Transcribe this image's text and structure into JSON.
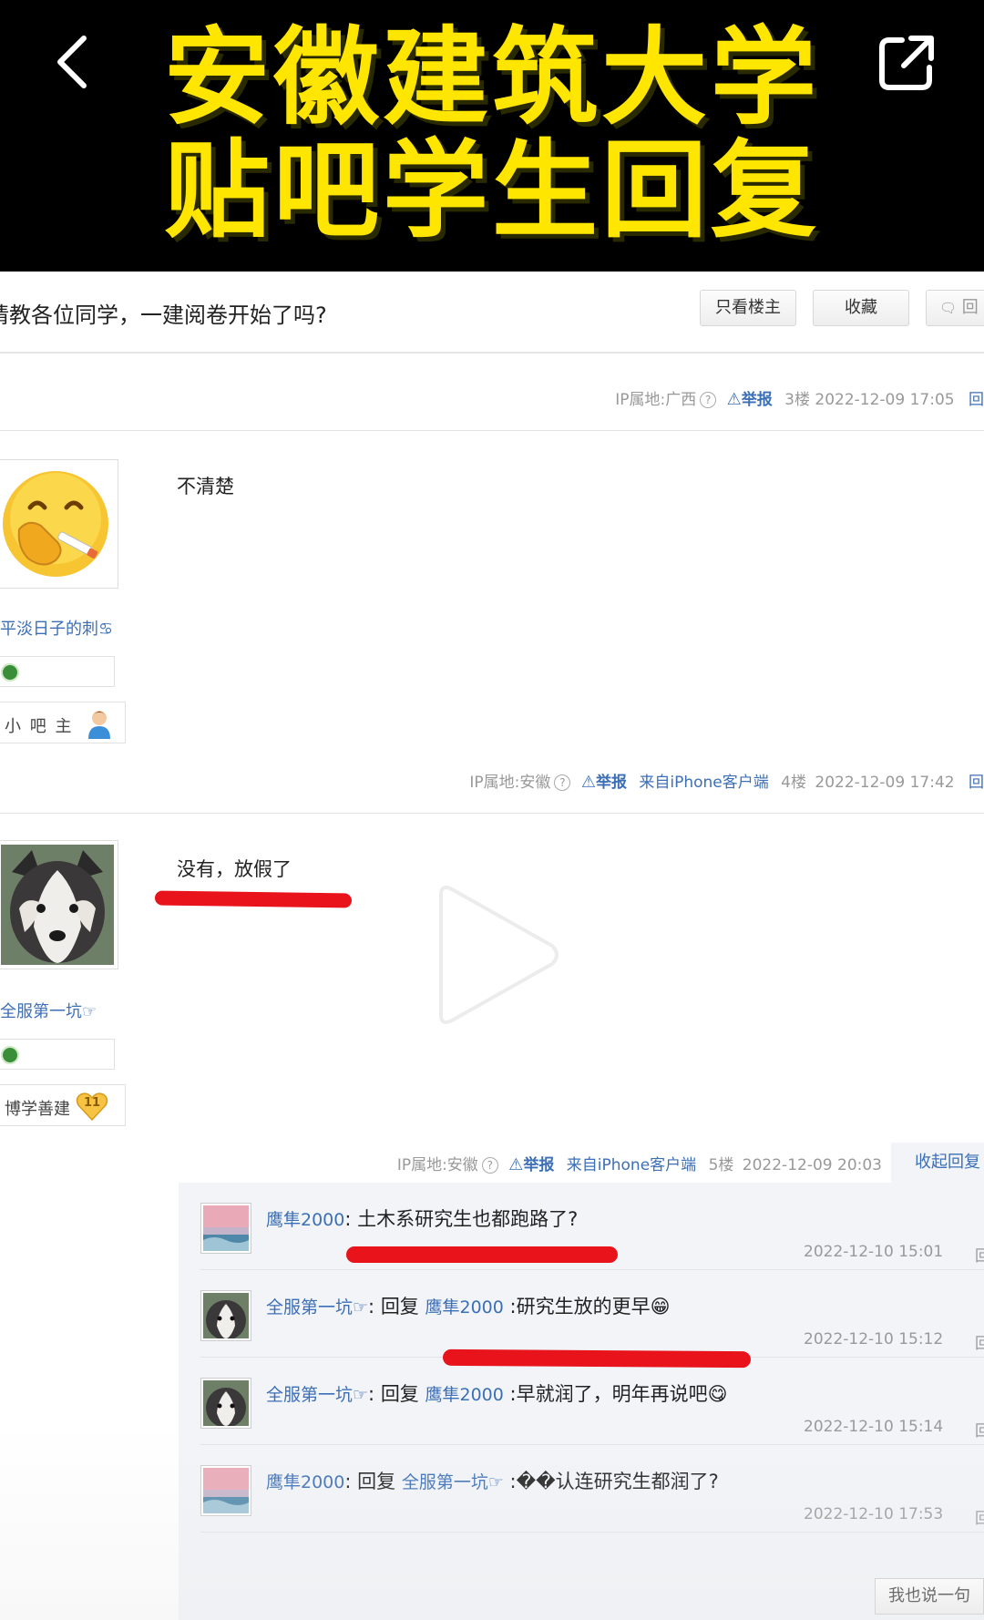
{
  "banner": {
    "line1": "安徽建筑大学",
    "line2": "贴吧学生回复",
    "accent": "#ffe600"
  },
  "thread": {
    "title": "请教各位同学，一建阅卷开始了吗?",
    "buttons": [
      "只看楼主",
      "收藏",
      "回"
    ]
  },
  "floor3_meta": {
    "ip": "IP属地:广西",
    "report": "举报",
    "floor": "3楼",
    "time": "2022-12-09 17:05",
    "cut": "回"
  },
  "post4": {
    "username": "平淡日子的刺♋",
    "role": "小 吧 主",
    "text": "不清楚",
    "meta": {
      "ip": "IP属地:安徽",
      "report": "举报",
      "source": "来自iPhone客户端",
      "floor": "4楼",
      "time": "2022-12-09 17:42",
      "cut": "回"
    }
  },
  "post5": {
    "username": "全服第一坑☞",
    "role": "博学善建",
    "level": "11",
    "text": "没有，放假了",
    "meta": {
      "ip": "IP属地:安徽",
      "report": "举报",
      "source": "来自iPhone客户端",
      "floor": "5楼",
      "time": "2022-12-09 20:03"
    },
    "collapse": "收起回复"
  },
  "comments": [
    {
      "user": "鹰隼2000",
      "sep": ": ",
      "prefix": "",
      "target": "",
      "text": "土木系研究生也都跑路了?",
      "time": "2022-12-10 15:01",
      "reply": "回复",
      "avatar": "sunset"
    },
    {
      "user": "全服第一坑☞",
      "sep": ": ",
      "prefix": "回复 ",
      "target": "鹰隼2000",
      "text": " :研究生放的更早😁",
      "time": "2022-12-10 15:12",
      "reply": "回复",
      "avatar": "husky"
    },
    {
      "user": "全服第一坑☞",
      "sep": ": ",
      "prefix": "回复 ",
      "target": "鹰隼2000",
      "text": " :早就润了，明年再说吧😋",
      "time": "2022-12-10 15:14",
      "reply": "回复",
      "avatar": "husky"
    },
    {
      "user": "鹰隼2000",
      "sep": ": ",
      "prefix": "回复 ",
      "target": "全服第一坑☞",
      "text": " :��认连研究生都润了?",
      "time": "2022-12-10 17:53",
      "reply": "回复",
      "avatar": "sunset"
    }
  ],
  "say_button": "我也说一句",
  "icons": [
    "back-arrow-icon",
    "share-icon",
    "warning-triangle-icon",
    "help-circle-icon",
    "play-icon",
    "user-role-icon",
    "level-heart-icon"
  ]
}
